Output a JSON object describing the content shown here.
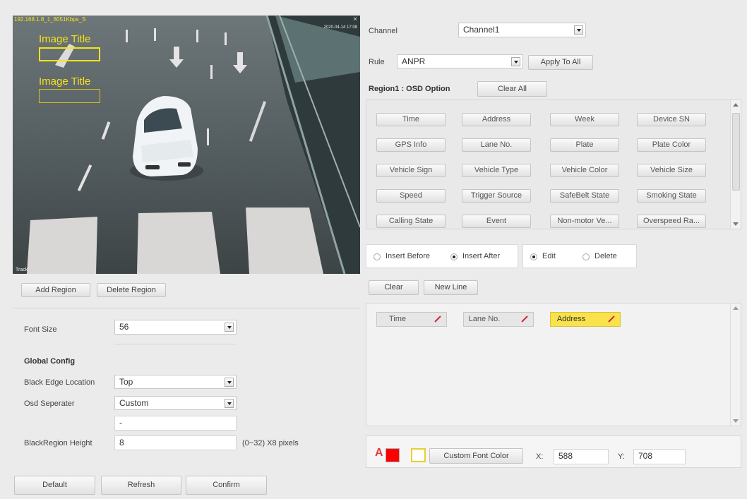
{
  "video": {
    "stream_info": "192.168.1.8_1_8051Kbps_S",
    "timestamp": "2020-04-14 17:08",
    "channel_tag": "Track",
    "overlay_titles": [
      "Image Title",
      "Image Title"
    ]
  },
  "region_buttons": {
    "add": "Add Region",
    "delete": "Delete Region"
  },
  "config": {
    "font_size_label": "Font Size",
    "font_size_value": "56",
    "global_config_title": "Global Config",
    "black_edge_label": "Black Edge Location",
    "black_edge_value": "Top",
    "osd_sep_label": "Osd Seperater",
    "osd_sep_value": "Custom",
    "sep_text": "-",
    "black_region_label": "BlackRegion Height",
    "black_region_value": "8",
    "black_region_hint": "(0~32)  X8 pixels"
  },
  "footer_buttons": {
    "default": "Default",
    "refresh": "Refresh",
    "confirm": "Confirm"
  },
  "channel": {
    "label": "Channel",
    "value": "Channel1"
  },
  "rule": {
    "label": "Rule",
    "value": "ANPR",
    "apply_all": "Apply To All"
  },
  "osd_option": {
    "title": "Region1 : OSD Option",
    "clear_all": "Clear All",
    "items": [
      "Time",
      "Address",
      "Week",
      "Device SN",
      "GPS Info",
      "Lane No.",
      "Plate",
      "Plate Color",
      "Vehicle Sign",
      "Vehicle Type",
      "Vehicle Color",
      "Vehicle Size",
      "Speed",
      "Trigger Source",
      "SafeBelt State",
      "Smoking State",
      "Calling State",
      "Event",
      "Non-motor Ve...",
      "Overspeed Ra..."
    ]
  },
  "insert": {
    "before": "Insert Before",
    "after": "Insert After",
    "selected": "after"
  },
  "mode": {
    "edit": "Edit",
    "delete": "Delete",
    "selected": "edit"
  },
  "line_buttons": {
    "clear": "Clear",
    "new_line": "New Line"
  },
  "selected_items": [
    {
      "label": "Time",
      "highlight": false
    },
    {
      "label": "Lane No.",
      "highlight": false
    },
    {
      "label": "Address",
      "highlight": true
    }
  ],
  "font_color": {
    "button": "Custom Font Color",
    "swatch_primary": "#ff0000",
    "swatch_secondary": "#ffffff",
    "x_label": "X:",
    "x_value": "588",
    "y_label": "Y:",
    "y_value": "708"
  }
}
